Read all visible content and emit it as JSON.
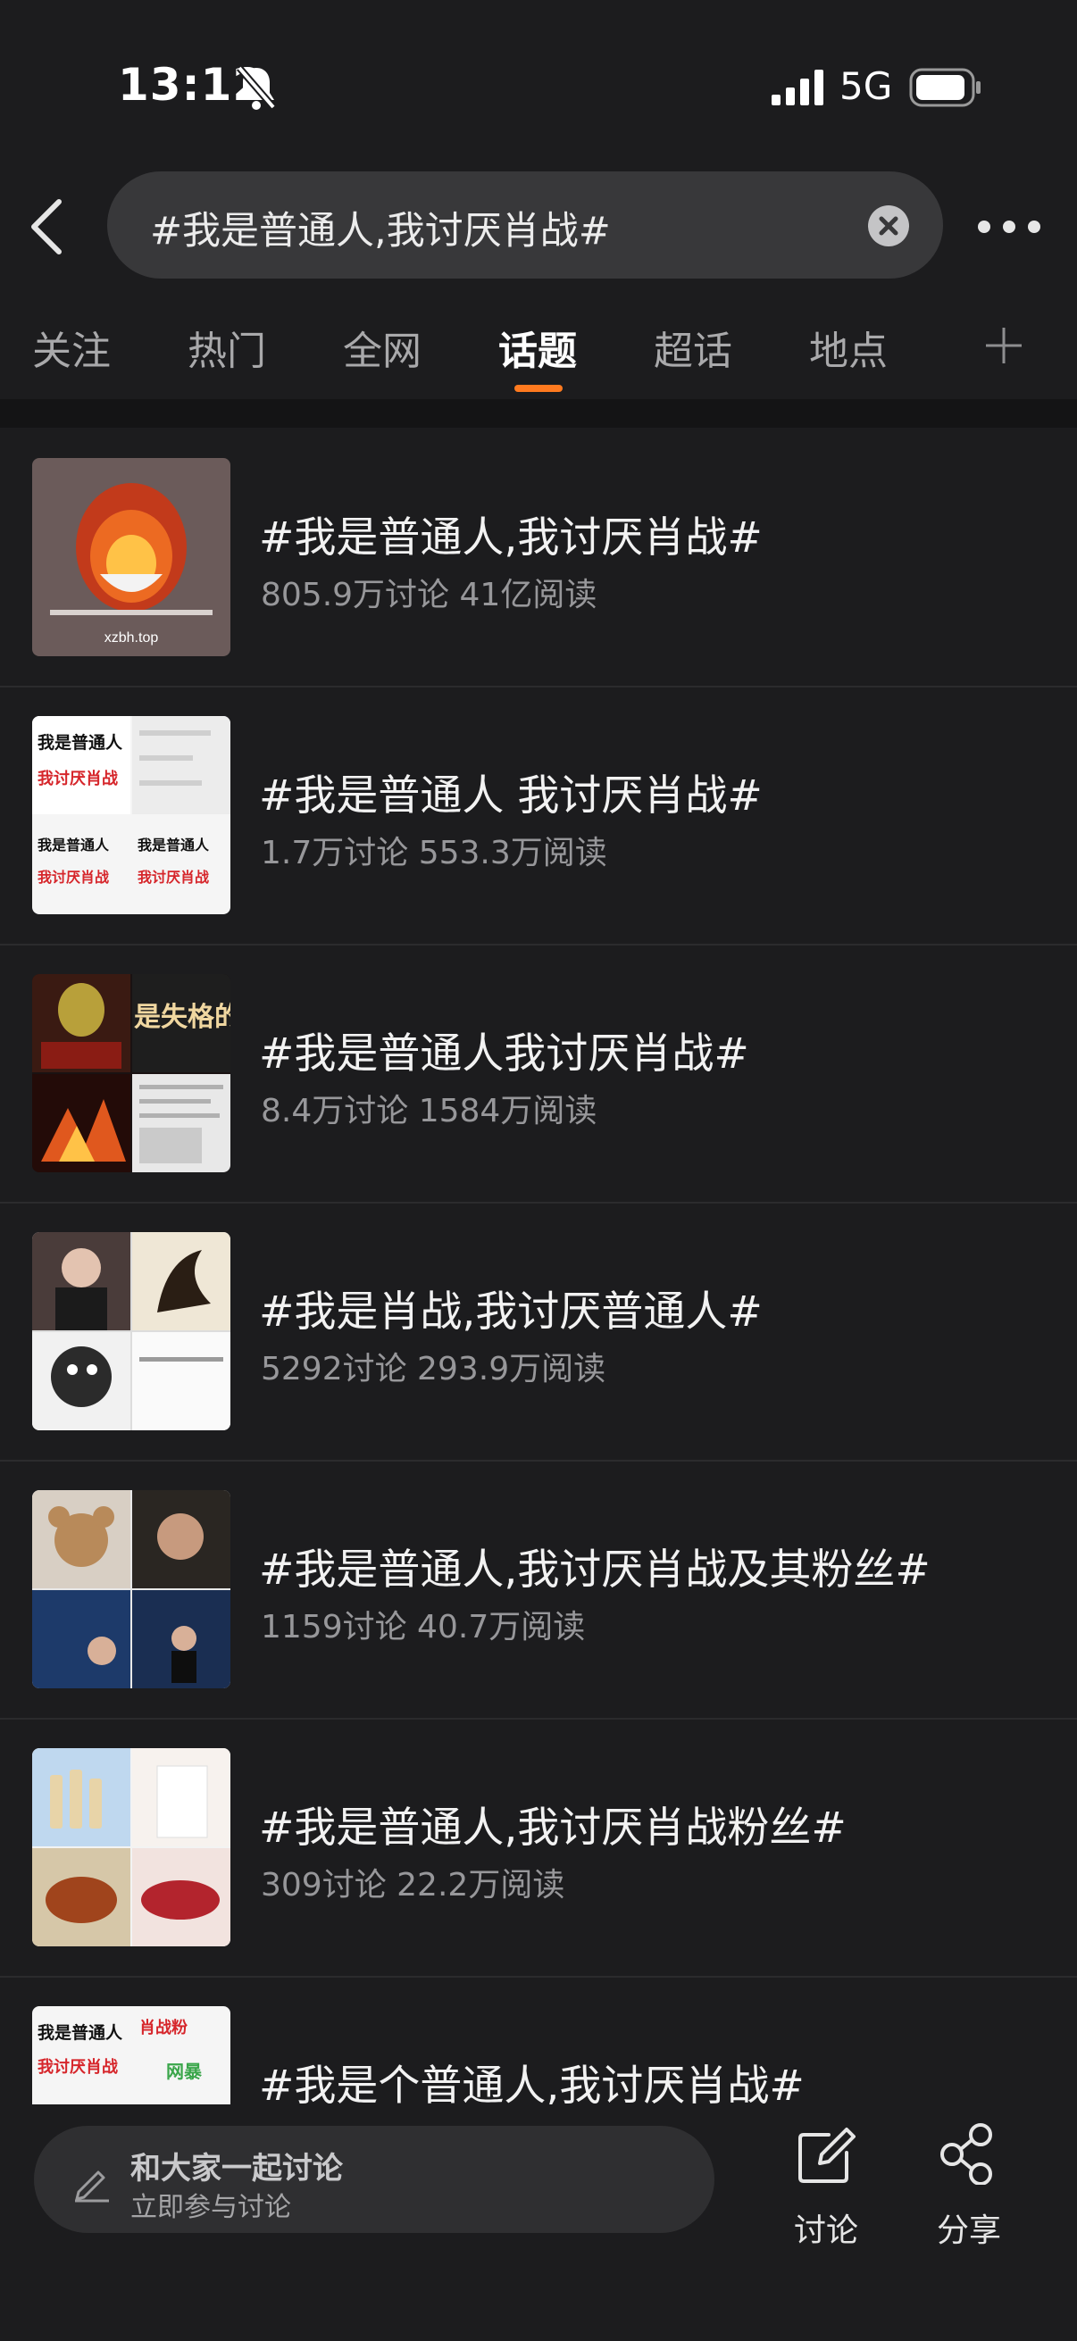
{
  "status_bar": {
    "time": "13:12",
    "network": "5G"
  },
  "search": {
    "query": "#我是普通人,我讨厌肖战#"
  },
  "tabs": [
    {
      "label": "关注"
    },
    {
      "label": "热门"
    },
    {
      "label": "全网"
    },
    {
      "label": "话题"
    },
    {
      "label": "超话"
    },
    {
      "label": "地点"
    }
  ],
  "active_tab": "话题",
  "topics": [
    {
      "title": "#我是普通人,我讨厌肖战#",
      "stats": "805.9万讨论 41亿阅读",
      "thumb_text": "xzbh.top"
    },
    {
      "title": "#我是普通人 我讨厌肖战#",
      "stats": "1.7万讨论 553.3万阅读",
      "thumb_text_a": "我是普通人",
      "thumb_text_b": "我讨厌肖战"
    },
    {
      "title": "#我是普通人我讨厌肖战#",
      "stats": "8.4万讨论 1584万阅读",
      "thumb_text": "是失格的偶"
    },
    {
      "title": "#我是肖战,我讨厌普通人#",
      "stats": "5292讨论 293.9万阅读"
    },
    {
      "title": "#我是普通人,我讨厌肖战及其粉丝#",
      "stats": "1159讨论 40.7万阅读"
    },
    {
      "title": "#我是普通人,我讨厌肖战粉丝#",
      "stats": "309讨论 22.2万阅读"
    },
    {
      "title": "#我是个普通人,我讨厌肖战#",
      "stats": "",
      "thumb_text_a": "我是普通人",
      "thumb_text_b": "我讨厌肖战",
      "thumb_text_c": "肖战粉",
      "thumb_text_d": "网暴"
    }
  ],
  "bottom_bar": {
    "compose_main": "和大家一起讨论",
    "compose_sub": "立即参与讨论",
    "discuss_label": "讨论",
    "share_label": "分享"
  },
  "colors": {
    "background": "#1c1c1e",
    "accent": "#ff7a1f",
    "text_primary": "#f2f2f2",
    "text_secondary": "#97979a"
  },
  "icons": [
    "bell-muted-icon",
    "signal-icon",
    "battery-icon",
    "back-arrow-icon",
    "clear-icon",
    "more-icon",
    "plus-icon",
    "pencil-icon",
    "compose-icon",
    "share-icon"
  ]
}
